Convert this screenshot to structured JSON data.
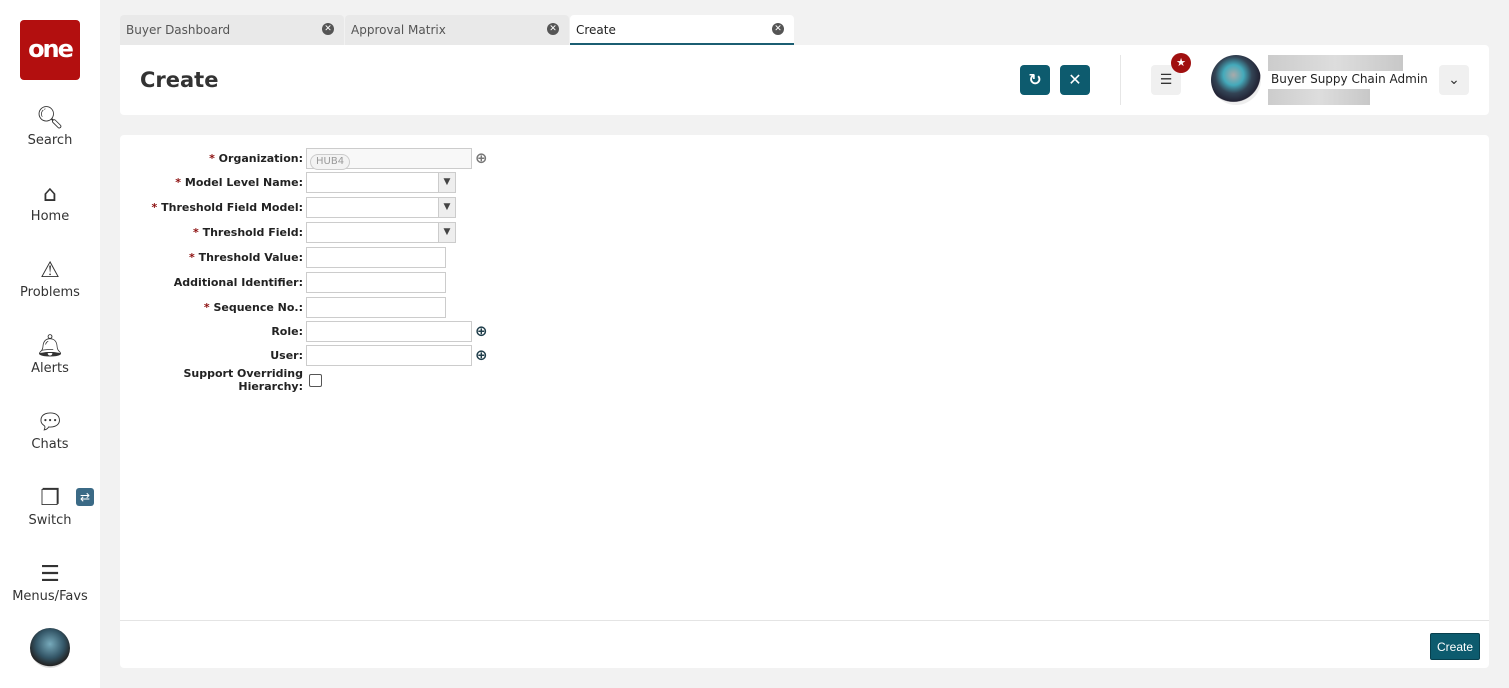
{
  "sidebar": {
    "logo": "one",
    "items": [
      {
        "label": "Search",
        "icon": "search-icon"
      },
      {
        "label": "Home",
        "icon": "home-icon"
      },
      {
        "label": "Problems",
        "icon": "warning-icon"
      },
      {
        "label": "Alerts",
        "icon": "bell-icon"
      },
      {
        "label": "Chats",
        "icon": "chat-icon"
      },
      {
        "label": "Switch",
        "icon": "switch-icon"
      },
      {
        "label": "Menus/Favs",
        "icon": "menu-icon"
      }
    ]
  },
  "tabs": [
    {
      "label": "Buyer Dashboard"
    },
    {
      "label": "Approval Matrix"
    },
    {
      "label": "Create",
      "active": true
    }
  ],
  "header": {
    "title": "Create",
    "user_role": "Buyer Suppy Chain Admin"
  },
  "form": {
    "organization": {
      "label": "Organization:",
      "value": "HUB4"
    },
    "model_level_name": {
      "label": "Model Level Name:",
      "value": ""
    },
    "threshold_field_model": {
      "label": "Threshold Field Model:",
      "value": ""
    },
    "threshold_field": {
      "label": "Threshold Field:",
      "value": ""
    },
    "threshold_value": {
      "label": "Threshold Value:",
      "value": ""
    },
    "additional_identifier": {
      "label": "Additional Identifier:",
      "value": ""
    },
    "sequence_no": {
      "label": "Sequence No.:",
      "value": ""
    },
    "role": {
      "label": "Role:",
      "value": ""
    },
    "user": {
      "label": "User:",
      "value": ""
    },
    "support_overriding_hierarchy": {
      "label": "Support Overriding Hierarchy:",
      "checked": false
    },
    "required_mark": "*"
  },
  "footer": {
    "create_label": "Create"
  },
  "colors": {
    "brand": "#b30f0f",
    "accent": "#0d5b6e"
  }
}
